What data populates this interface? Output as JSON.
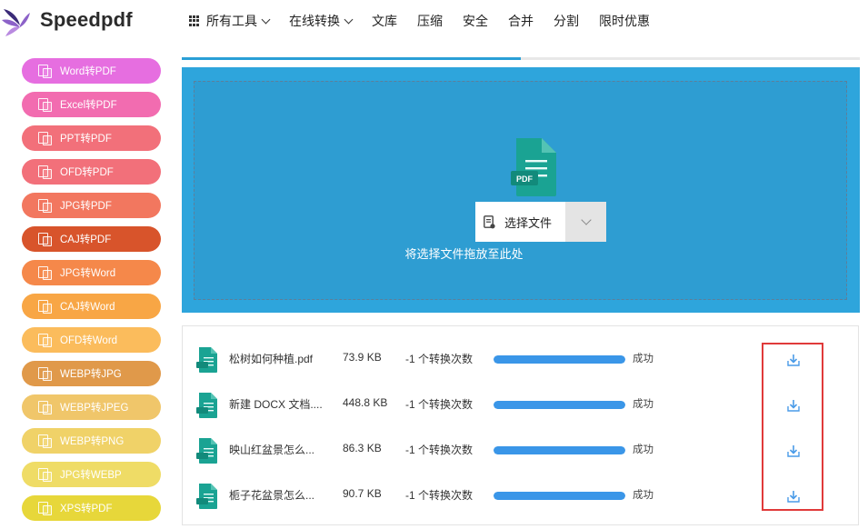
{
  "brand": {
    "name": "Speedpdf",
    "logo_colors": [
      "#3b2b78",
      "#8c62c8",
      "#b98ae0"
    ]
  },
  "nav": {
    "items": [
      {
        "label": "所有工具",
        "has_dropdown": true,
        "has_grid_icon": true
      },
      {
        "label": "在线转换",
        "has_dropdown": true,
        "has_grid_icon": false
      },
      {
        "label": "文库",
        "has_dropdown": false,
        "has_grid_icon": false
      },
      {
        "label": "压缩",
        "has_dropdown": false,
        "has_grid_icon": false
      },
      {
        "label": "安全",
        "has_dropdown": false,
        "has_grid_icon": false
      },
      {
        "label": "合并",
        "has_dropdown": false,
        "has_grid_icon": false
      },
      {
        "label": "分割",
        "has_dropdown": false,
        "has_grid_icon": false
      },
      {
        "label": "限时优惠",
        "has_dropdown": false,
        "has_grid_icon": false
      }
    ]
  },
  "sidebar": {
    "items": [
      {
        "label": "Word转PDF",
        "color": "#e66ee0"
      },
      {
        "label": "Excel转PDF",
        "color": "#f26cb0"
      },
      {
        "label": "PPT转PDF",
        "color": "#f2707a"
      },
      {
        "label": "OFD转PDF",
        "color": "#f2707a"
      },
      {
        "label": "JPG转PDF",
        "color": "#f2775f"
      },
      {
        "label": "CAJ转PDF",
        "color": "#d8542b"
      },
      {
        "label": "JPG转Word",
        "color": "#f5884a"
      },
      {
        "label": "CAJ转Word",
        "color": "#f8a645"
      },
      {
        "label": "OFD转Word",
        "color": "#fbbc5c"
      },
      {
        "label": "WEBP转JPG",
        "color": "#e0994a"
      },
      {
        "label": "WEBP转JPEG",
        "color": "#f0c66a"
      },
      {
        "label": "WEBP转PNG",
        "color": "#f0d268"
      },
      {
        "label": "JPG转WEBP",
        "color": "#efdc66"
      },
      {
        "label": "XPS转PDF",
        "color": "#e7d73a"
      }
    ]
  },
  "upload": {
    "top_progress": 0.5,
    "choose_file_label": "选择文件",
    "drop_hint": "将选择文件拖放至此处",
    "file_icon_label": "PDF",
    "bg_color": "#2ea5dc",
    "icon_color": "#1aa393"
  },
  "files": [
    {
      "name": "松树如何种植.pdf",
      "size": "73.9 KB",
      "count_text": "-1 个转换次数",
      "progress": 1.0,
      "status": "成功"
    },
    {
      "name": "新建 DOCX 文档....",
      "size": "448.8 KB",
      "count_text": "-1 个转换次数",
      "progress": 1.0,
      "status": "成功"
    },
    {
      "name": "映山红盆景怎么...",
      "size": "86.3 KB",
      "count_text": "-1 个转换次数",
      "progress": 1.0,
      "status": "成功"
    },
    {
      "name": "栀子花盆景怎么...",
      "size": "90.7 KB",
      "count_text": "-1 个转换次数",
      "progress": 1.0,
      "status": "成功"
    }
  ],
  "colors": {
    "highlight_box": "#e03a3a",
    "progress_fill": "#3a96e8",
    "download_icon": "#4a9be8"
  }
}
